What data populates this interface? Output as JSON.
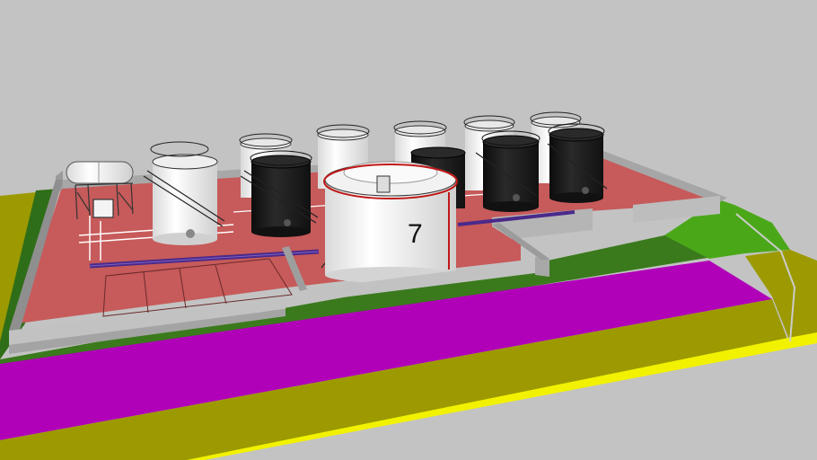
{
  "scene": {
    "featured_tank_label": "7",
    "colors": {
      "sky": "#c3c3c3",
      "grass": "#3a7a1c",
      "bright_grass": "#4aa818",
      "olive_ground": "#9c9a00",
      "magenta_strip": "#b000b8",
      "yellow_line": "#f2f200",
      "pad_red": "#c75a5a",
      "wall": "#bdbdbd",
      "tank_white": "#f4f4f4",
      "tank_black": "#1c1c1c",
      "tank_rim_red": "#c01818",
      "pipe_purple": "#4a2a8a"
    }
  }
}
